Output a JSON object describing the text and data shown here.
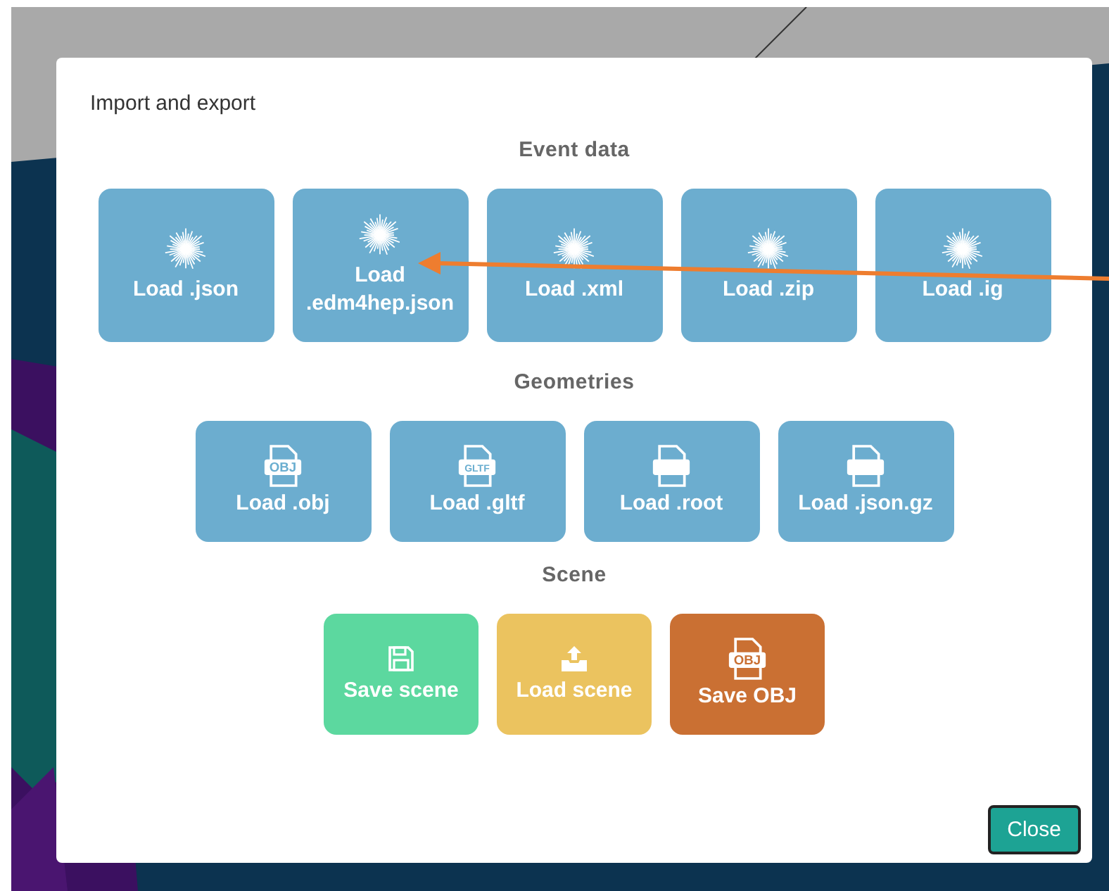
{
  "dialog": {
    "title": "Import and export",
    "sections": [
      {
        "heading": "Event data",
        "buttons": [
          {
            "label": "Load .json",
            "kind": "starburst"
          },
          {
            "label": "Load .edm4hep.json",
            "kind": "starburst"
          },
          {
            "label": "Load .xml",
            "kind": "starburst"
          },
          {
            "label": "Load .zip",
            "kind": "starburst"
          },
          {
            "label": "Load .ig",
            "kind": "starburst"
          }
        ]
      },
      {
        "heading": "Geometries",
        "buttons": [
          {
            "label": "Load .obj",
            "kind": "file-badge",
            "badge": "OBJ"
          },
          {
            "label": "Load .gltf",
            "kind": "file-badge",
            "badge": "GLTF"
          },
          {
            "label": "Load .root",
            "kind": "file-band"
          },
          {
            "label": "Load .json.gz",
            "kind": "file-band"
          }
        ]
      },
      {
        "heading": "Scene",
        "buttons": [
          {
            "label": "Save scene",
            "kind": "floppy",
            "color": "#5cd89f"
          },
          {
            "label": "Load scene",
            "kind": "tray-upload",
            "color": "#ebc35f"
          },
          {
            "label": "Save OBJ",
            "kind": "file-badge",
            "badge": "OBJ",
            "color": "#ca7033"
          }
        ]
      }
    ],
    "close_button": "Close"
  }
}
